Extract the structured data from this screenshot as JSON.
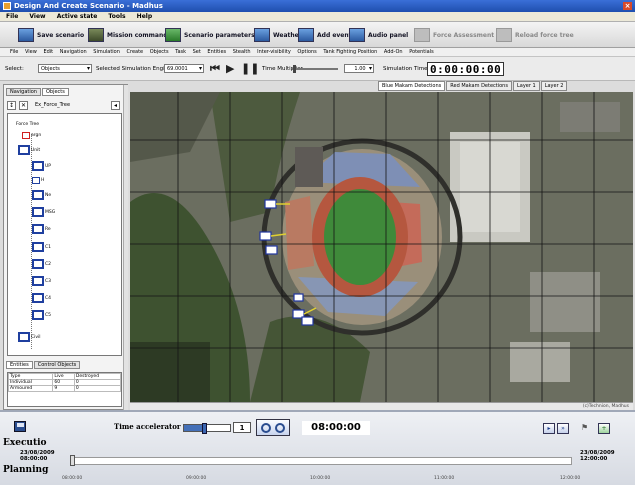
{
  "window": {
    "title": "Design And Create Scenario - Madhus"
  },
  "menubar": [
    "File",
    "View",
    "Active state",
    "Tools",
    "Help"
  ],
  "toolbar": {
    "buttons": [
      {
        "label": "Save scenario",
        "enabled": true
      },
      {
        "label": "Mission command",
        "enabled": true
      },
      {
        "label": "Scenario parameters",
        "enabled": true
      },
      {
        "label": "Weather",
        "enabled": true
      },
      {
        "label": "Add event",
        "enabled": true
      },
      {
        "label": "Audio panel",
        "enabled": true
      },
      {
        "label": "Force Assessment",
        "enabled": false
      },
      {
        "label": "Reload force tree",
        "enabled": false
      }
    ]
  },
  "menu2": [
    "File",
    "View",
    "Edit",
    "Navigation",
    "Simulation",
    "Create",
    "Objects",
    "Task",
    "Set",
    "Entities",
    "Stealth",
    "Inter-visibility",
    "Options",
    "Tank Fighting Position",
    "Add-On",
    "Potentials"
  ],
  "controls": {
    "select_label": "Select:",
    "select_value": "Objects",
    "engine_label": "Selected Simulation Engine",
    "engine_value": "69.0001",
    "multiplier_label": "Time Multiplier",
    "multiplier_value": "1.00",
    "simtime_label": "Simulation Time",
    "simtime_value": "0:00:00:00"
  },
  "map_tabs": [
    {
      "label": "Blue Makam Detections",
      "active": true
    },
    {
      "label": "Red Makam Detections",
      "active": false
    },
    {
      "label": "Layer 1",
      "active": false
    },
    {
      "label": "Layer 2",
      "active": false
    }
  ],
  "left_panel": {
    "tabs": [
      {
        "label": "Navigation",
        "active": false
      },
      {
        "label": "Objects",
        "active": true
      }
    ],
    "tree_tab": "Ex_Force_Tree",
    "tree_root": "Force Tree",
    "nodes": [
      "argn",
      "Unit",
      "UP",
      "H",
      "Ne",
      "MSG",
      "Re",
      "C1",
      "C2",
      "C3",
      "C4",
      "C5",
      "Civil"
    ],
    "bottom_tabs": [
      "Entities",
      "Control Objects"
    ],
    "grid_headers": [
      "Type",
      "Live",
      "Destroyed"
    ],
    "grid_rows": [
      [
        "Individual",
        "60",
        "0"
      ],
      [
        "Armoured",
        "9",
        "0"
      ]
    ]
  },
  "map_footer": "(c)Technion, Madhus",
  "bottom": {
    "time_accelerator_label": "Time accelerator",
    "accelerator_value": "1",
    "accelerator_level": 0.45,
    "clock": "08:00:00",
    "execution_label": "Executio",
    "planning_label": "Planning",
    "start_date": "23/08/2009",
    "start_time": "08:00:00",
    "end_date": "23/08/2009",
    "end_time": "12:00:00",
    "ticks": [
      "08:00:00",
      "09:00:00",
      "10:00:00",
      "11:00:00",
      "12:00:00"
    ]
  },
  "colors": {
    "title_bar": "#2a5cc4",
    "accent": "#2a4d8f",
    "map_grid": "#1a1a1a"
  }
}
